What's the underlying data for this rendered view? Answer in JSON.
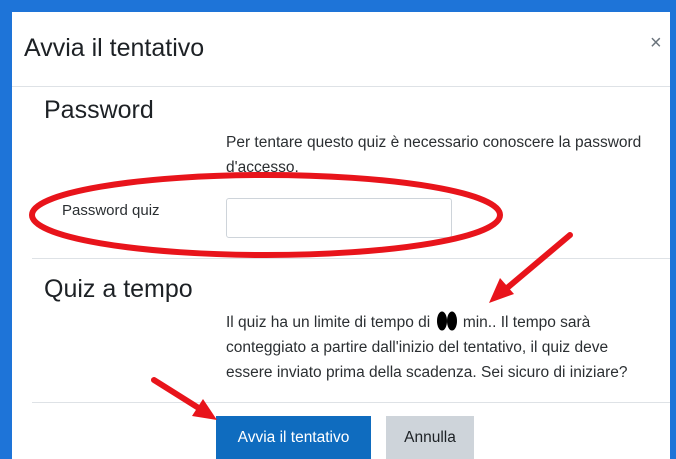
{
  "dialog": {
    "title": "Avvia il tentativo",
    "close_label": "×"
  },
  "password_section": {
    "title": "Password",
    "info_line1": "Per tentare questo quiz è necessario conoscere la password",
    "info_line2": "d'accesso.",
    "field_label": "Password quiz",
    "field_value": ""
  },
  "time_section": {
    "title": "Quiz a tempo",
    "line1_before": "Il quiz ha un limite di tempo di",
    "line1_after": "min.. Il tempo sarà",
    "line2": "conteggiato a partire dall'inizio del tentativo, il quiz deve",
    "line3": "essere inviato prima della scadenza. Sei sicuro di iniziare?"
  },
  "buttons": {
    "start_label": "Avvia il tentativo",
    "cancel_label": "Annulla"
  },
  "colors": {
    "frame": "#1e74d8",
    "primary_button": "#0f6cbf",
    "secondary_button": "#ced4da",
    "annotation": "#e8141b",
    "redaction": "#000000"
  },
  "icons": {
    "close": "close-icon"
  }
}
